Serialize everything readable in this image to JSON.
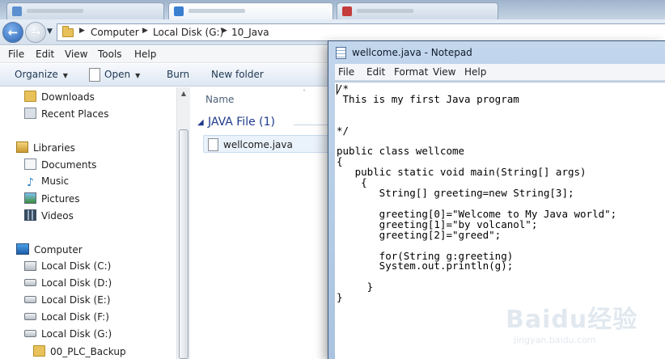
{
  "explorer": {
    "breadcrumb": [
      "Computer",
      "Local Disk (G:)",
      "10_Java"
    ],
    "menu": [
      "File",
      "Edit",
      "View",
      "Tools",
      "Help"
    ],
    "commands": {
      "organize": "Organize",
      "open": "Open",
      "burn": "Burn",
      "new_folder": "New folder"
    },
    "nav": {
      "favorites": [
        "Downloads",
        "Recent Places"
      ],
      "libraries_header": "Libraries",
      "libraries": [
        "Documents",
        "Music",
        "Pictures",
        "Videos"
      ],
      "computer_header": "Computer",
      "drives": [
        "Local Disk (C:)",
        "Local Disk (D:)",
        "Local Disk (E:)",
        "Local Disk (F:)",
        "Local Disk (G:)"
      ],
      "subfolder": "00_PLC_Backup"
    },
    "content": {
      "column_name": "Name",
      "group_title": "JAVA File (1)",
      "files": [
        "wellcome.java"
      ]
    }
  },
  "notepad": {
    "title": "wellcome.java - Notepad",
    "menu": [
      "File",
      "Edit",
      "Format",
      "View",
      "Help"
    ],
    "content": "/*\n This is my first Java program\n\n\n*/\n\npublic class wellcome\n{\n   public static void main(String[] args)\n    {\n       String[] greeting=new String[3];\n\n       greeting[0]=\"Welcome to My Java world\";\n       greeting[1]=\"by volcanol\";\n       greeting[2]=\"greed\";\n\n       for(String g:greeting)\n       System.out.println(g);\n\n     }\n}"
  },
  "watermark": {
    "text": "Baidu经验",
    "url": "jingyan.baidu.com"
  }
}
